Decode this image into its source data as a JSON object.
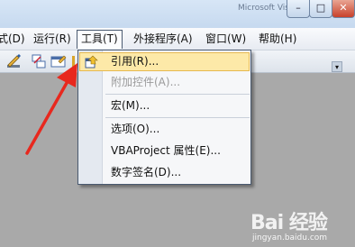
{
  "window": {
    "title": "Microsoft Visual Basic"
  },
  "menubar": {
    "items": [
      {
        "id": "view",
        "label": "式(D)"
      },
      {
        "id": "run",
        "label": "运行(R)"
      },
      {
        "id": "tools",
        "label": "工具(T)"
      },
      {
        "id": "addins",
        "label": "外接程序(A)"
      },
      {
        "id": "window",
        "label": "窗口(W)"
      },
      {
        "id": "help",
        "label": "帮助(H)"
      }
    ]
  },
  "toolbar": {
    "icons": [
      "design-mode-icon",
      "project-explorer-icon",
      "properties-window-icon",
      "object-browser-icon"
    ],
    "overflow_glyph": "▾"
  },
  "tools_menu": {
    "items": [
      {
        "label": "引用(R)...",
        "enabled": true,
        "highlighted": true,
        "icon": "references-icon"
      },
      {
        "label": "附加控件(A)...",
        "enabled": false
      },
      {
        "label": "宏(M)...",
        "enabled": true
      },
      {
        "label": "选项(O)...",
        "enabled": true
      },
      {
        "label": "VBAProject 属性(E)...",
        "enabled": true
      },
      {
        "label": "数字签名(D)...",
        "enabled": true
      }
    ]
  },
  "annotation": {
    "type": "arrow",
    "color": "#e8281e",
    "points_to": "references-menu-item"
  },
  "watermark": {
    "logo": "Bai 经验",
    "url": "jingyan.baidu.com"
  },
  "colors": {
    "highlight_bg": "#fde9a8",
    "highlight_border": "#e7b94f",
    "disabled_text": "#9a9a9a"
  }
}
